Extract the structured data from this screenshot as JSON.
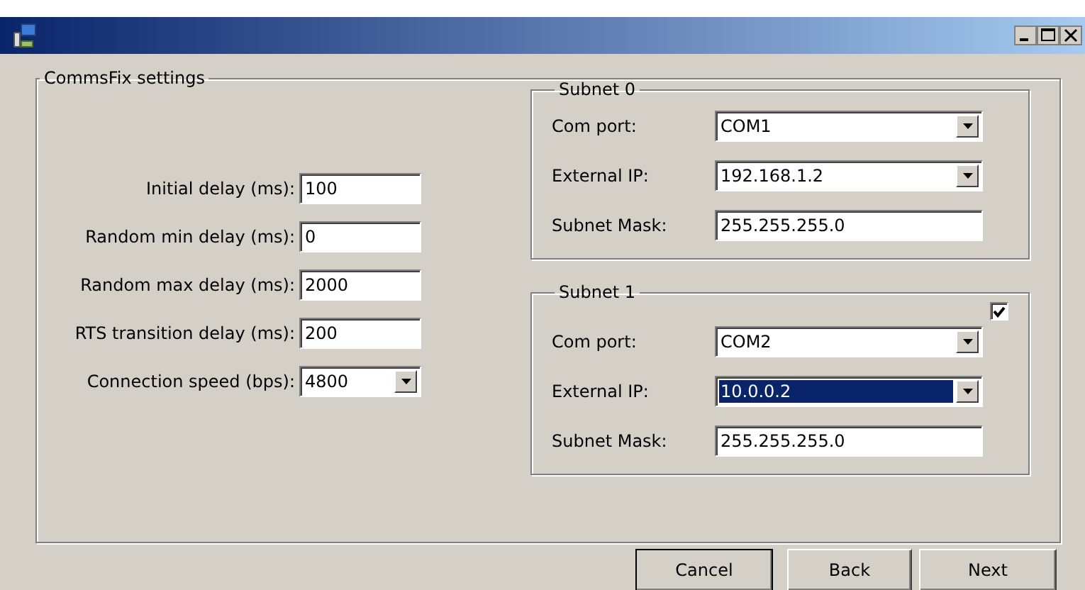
{
  "settings_group": {
    "title": "CommsFix settings",
    "fields": [
      {
        "label": "Initial delay (ms):",
        "value": "100",
        "kind": "text"
      },
      {
        "label": "Random min delay (ms):",
        "value": "0",
        "kind": "text"
      },
      {
        "label": "Random max delay (ms):",
        "value": "2000",
        "kind": "text"
      },
      {
        "label": "RTS transition delay (ms):",
        "value": "200",
        "kind": "text"
      },
      {
        "label": "Connection speed (bps):",
        "value": "4800",
        "kind": "dropdown"
      }
    ]
  },
  "subnets": [
    {
      "title": "Subnet 0",
      "fields": [
        {
          "label": "Com port:",
          "value": "COM1",
          "kind": "dropdown",
          "selected": false
        },
        {
          "label": "External IP:",
          "value": "192.168.1.2",
          "kind": "dropdown",
          "selected": false
        },
        {
          "label": "Subnet Mask:",
          "value": "255.255.255.0",
          "kind": "text",
          "selected": false
        }
      ]
    },
    {
      "title": "Subnet 1",
      "checkbox": {
        "checked": true
      },
      "fields": [
        {
          "label": "Com port:",
          "value": "COM2",
          "kind": "dropdown",
          "selected": false
        },
        {
          "label": "External IP:",
          "value": "10.0.0.2",
          "kind": "dropdown",
          "selected": true
        },
        {
          "label": "Subnet Mask:",
          "value": "255.255.255.0",
          "kind": "text",
          "selected": false
        }
      ]
    }
  ],
  "buttons": [
    {
      "label": "Cancel",
      "default": true
    },
    {
      "label": "Back",
      "default": false
    },
    {
      "label": "Next",
      "default": false
    }
  ]
}
